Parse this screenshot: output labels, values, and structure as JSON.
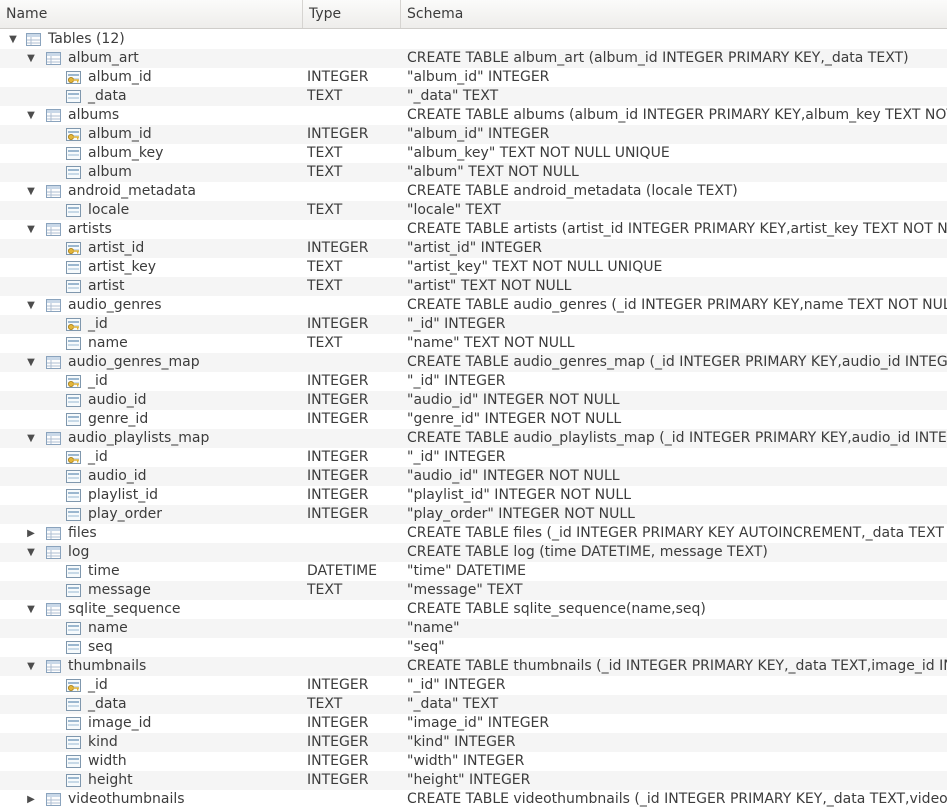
{
  "columns": {
    "name": "Name",
    "type": "Type",
    "schema": "Schema"
  },
  "rows": [
    {
      "level": 0,
      "kind": "root",
      "expanded": true,
      "name": "Tables (12)",
      "type": "",
      "schema": ""
    },
    {
      "level": 1,
      "kind": "table",
      "expanded": true,
      "name": "album_art",
      "type": "",
      "schema": "CREATE TABLE album_art (album_id INTEGER PRIMARY KEY,_data TEXT)"
    },
    {
      "level": 2,
      "kind": "key",
      "name": "album_id",
      "type": "INTEGER",
      "schema": "\"album_id\" INTEGER"
    },
    {
      "level": 2,
      "kind": "field",
      "name": "_data",
      "type": "TEXT",
      "schema": "\"_data\" TEXT"
    },
    {
      "level": 1,
      "kind": "table",
      "expanded": true,
      "name": "albums",
      "type": "",
      "schema": "CREATE TABLE albums (album_id INTEGER PRIMARY KEY,album_key TEXT NOT NULL UNIQUE,album TEXT NOT NULL)"
    },
    {
      "level": 2,
      "kind": "key",
      "name": "album_id",
      "type": "INTEGER",
      "schema": "\"album_id\" INTEGER"
    },
    {
      "level": 2,
      "kind": "field",
      "name": "album_key",
      "type": "TEXT",
      "schema": "\"album_key\" TEXT NOT NULL UNIQUE"
    },
    {
      "level": 2,
      "kind": "field",
      "name": "album",
      "type": "TEXT",
      "schema": "\"album\" TEXT NOT NULL"
    },
    {
      "level": 1,
      "kind": "table",
      "expanded": true,
      "name": "android_metadata",
      "type": "",
      "schema": "CREATE TABLE android_metadata (locale TEXT)"
    },
    {
      "level": 2,
      "kind": "field",
      "name": "locale",
      "type": "TEXT",
      "schema": "\"locale\" TEXT"
    },
    {
      "level": 1,
      "kind": "table",
      "expanded": true,
      "name": "artists",
      "type": "",
      "schema": "CREATE TABLE artists (artist_id INTEGER PRIMARY KEY,artist_key TEXT NOT NULL UNIQUE,artist TEXT NOT NULL)"
    },
    {
      "level": 2,
      "kind": "key",
      "name": "artist_id",
      "type": "INTEGER",
      "schema": "\"artist_id\" INTEGER"
    },
    {
      "level": 2,
      "kind": "field",
      "name": "artist_key",
      "type": "TEXT",
      "schema": "\"artist_key\" TEXT NOT NULL UNIQUE"
    },
    {
      "level": 2,
      "kind": "field",
      "name": "artist",
      "type": "TEXT",
      "schema": "\"artist\" TEXT NOT NULL"
    },
    {
      "level": 1,
      "kind": "table",
      "expanded": true,
      "name": "audio_genres",
      "type": "",
      "schema": "CREATE TABLE audio_genres (_id INTEGER PRIMARY KEY,name TEXT NOT NULL)"
    },
    {
      "level": 2,
      "kind": "key",
      "name": "_id",
      "type": "INTEGER",
      "schema": "\"_id\" INTEGER"
    },
    {
      "level": 2,
      "kind": "field",
      "name": "name",
      "type": "TEXT",
      "schema": "\"name\" TEXT NOT NULL"
    },
    {
      "level": 1,
      "kind": "table",
      "expanded": true,
      "name": "audio_genres_map",
      "type": "",
      "schema": "CREATE TABLE audio_genres_map (_id INTEGER PRIMARY KEY,audio_id INTEGER NOT NULL,genre_id INTEGER NOT NULL)"
    },
    {
      "level": 2,
      "kind": "key",
      "name": "_id",
      "type": "INTEGER",
      "schema": "\"_id\" INTEGER"
    },
    {
      "level": 2,
      "kind": "field",
      "name": "audio_id",
      "type": "INTEGER",
      "schema": "\"audio_id\" INTEGER NOT NULL"
    },
    {
      "level": 2,
      "kind": "field",
      "name": "genre_id",
      "type": "INTEGER",
      "schema": "\"genre_id\" INTEGER NOT NULL"
    },
    {
      "level": 1,
      "kind": "table",
      "expanded": true,
      "name": "audio_playlists_map",
      "type": "",
      "schema": "CREATE TABLE audio_playlists_map (_id INTEGER PRIMARY KEY,audio_id INTEGER NOT NULL,playlist_id INTEGER NOT NULL,play_order INTEGER NOT NULL)"
    },
    {
      "level": 2,
      "kind": "key",
      "name": "_id",
      "type": "INTEGER",
      "schema": "\"_id\" INTEGER"
    },
    {
      "level": 2,
      "kind": "field",
      "name": "audio_id",
      "type": "INTEGER",
      "schema": "\"audio_id\" INTEGER NOT NULL"
    },
    {
      "level": 2,
      "kind": "field",
      "name": "playlist_id",
      "type": "INTEGER",
      "schema": "\"playlist_id\" INTEGER NOT NULL"
    },
    {
      "level": 2,
      "kind": "field",
      "name": "play_order",
      "type": "INTEGER",
      "schema": "\"play_order\" INTEGER NOT NULL"
    },
    {
      "level": 1,
      "kind": "table",
      "expanded": false,
      "name": "files",
      "type": "",
      "schema": "CREATE TABLE files (_id INTEGER PRIMARY KEY AUTOINCREMENT,_data TEXT UNIQUE"
    },
    {
      "level": 1,
      "kind": "table",
      "expanded": true,
      "name": "log",
      "type": "",
      "schema": "CREATE TABLE log (time DATETIME, message TEXT)"
    },
    {
      "level": 2,
      "kind": "field",
      "name": "time",
      "type": "DATETIME",
      "schema": "\"time\" DATETIME"
    },
    {
      "level": 2,
      "kind": "field",
      "name": "message",
      "type": "TEXT",
      "schema": "\"message\" TEXT"
    },
    {
      "level": 1,
      "kind": "table",
      "expanded": true,
      "name": "sqlite_sequence",
      "type": "",
      "schema": "CREATE TABLE sqlite_sequence(name,seq)"
    },
    {
      "level": 2,
      "kind": "field",
      "name": "name",
      "type": "",
      "schema": "\"name\""
    },
    {
      "level": 2,
      "kind": "field",
      "name": "seq",
      "type": "",
      "schema": "\"seq\""
    },
    {
      "level": 1,
      "kind": "table",
      "expanded": true,
      "name": "thumbnails",
      "type": "",
      "schema": "CREATE TABLE thumbnails (_id INTEGER PRIMARY KEY,_data TEXT,image_id INTEGER"
    },
    {
      "level": 2,
      "kind": "key",
      "name": "_id",
      "type": "INTEGER",
      "schema": "\"_id\" INTEGER"
    },
    {
      "level": 2,
      "kind": "field",
      "name": "_data",
      "type": "TEXT",
      "schema": "\"_data\" TEXT"
    },
    {
      "level": 2,
      "kind": "field",
      "name": "image_id",
      "type": "INTEGER",
      "schema": "\"image_id\" INTEGER"
    },
    {
      "level": 2,
      "kind": "field",
      "name": "kind",
      "type": "INTEGER",
      "schema": "\"kind\" INTEGER"
    },
    {
      "level": 2,
      "kind": "field",
      "name": "width",
      "type": "INTEGER",
      "schema": "\"width\" INTEGER"
    },
    {
      "level": 2,
      "kind": "field",
      "name": "height",
      "type": "INTEGER",
      "schema": "\"height\" INTEGER"
    },
    {
      "level": 1,
      "kind": "table",
      "expanded": false,
      "name": "videothumbnails",
      "type": "",
      "schema": "CREATE TABLE videothumbnails (_id INTEGER PRIMARY KEY,_data TEXT,video_id"
    }
  ]
}
